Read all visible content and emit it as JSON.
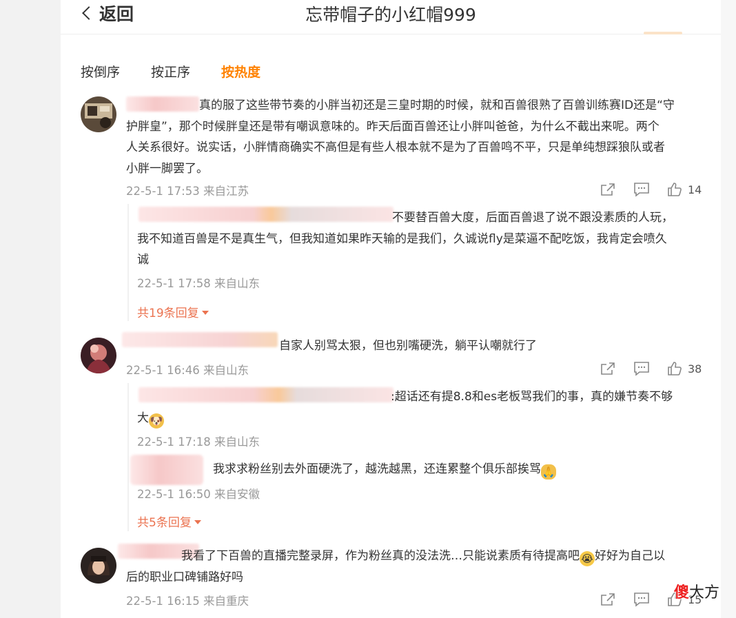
{
  "header": {
    "back_label": "返回",
    "title": "忘带帽子的小红帽999"
  },
  "sort_tabs": [
    {
      "label": "按倒序",
      "active": false
    },
    {
      "label": "按正序",
      "active": false
    },
    {
      "label": "按热度",
      "active": true
    }
  ],
  "comments": [
    {
      "text_lines": [
        "真的服了这些带节奏的小胖当初还是三皇时期的时候，就和百兽很熟了百兽训练赛ID还是“守",
        "护胖皇”，那个时候胖皇还是带有嘲讽意味的。昨天后面百兽还让小胖叫爸爸，为什么不截出来呢。两个",
        "人关系很好。说实话，小胖情商确实不高但是有些人根本就不是为了百兽鸣不平，只是单纯想踩狼队或者",
        "小胖一脚罢了。"
      ],
      "meta": "22-5-1 17:53 来自江苏",
      "likes": "14",
      "replies": [
        {
          "text_lines": [
            "不要替百兽大度，后面百兽退了说不跟没素质的人玩，",
            "我不知道百兽是不是真生气，但我知道如果昨天输的是我们，久诚说fly是菜逼不配吃饭，我肯定会喷久",
            "诚"
          ],
          "meta": "22-5-1 17:58 来自山东"
        }
      ],
      "more_label": "共19条回复"
    },
    {
      "text_lines": [
        "自家人别骂太狠，但也别嘴硬洗，躺平认嘲就行了"
      ],
      "meta": "22-5-1 16:46 来自山东",
      "likes": "38",
      "replies": [
        {
          "text_lines": [
            ":超话还有提8.8和es老板骂我们的事，真的嫌节奏不够",
            "大"
          ],
          "meta": "22-5-1 17:18 来自山东"
        },
        {
          "text_lines": [
            "我求求粉丝别去外面硬洗了，越洗越黑，还连累整个俱乐部挨骂"
          ],
          "meta": "22-5-1 16:50 来自安徽"
        }
      ],
      "more_label": "共5条回复"
    },
    {
      "text_lines": [
        "我看了下百兽的直播完整录屏，作为粉丝真的没法洗…只能说素质有待提高吧",
        "好好为自己以",
        "后的职业口碑铺路好吗"
      ],
      "meta": "22-5-1 16:15 来自重庆",
      "likes": "15"
    }
  ],
  "icons": {
    "share": "share-icon",
    "comment": "comment-icon",
    "like": "like-icon"
  },
  "watermark": {
    "part1": "傻",
    "part2": "大方"
  },
  "colors": {
    "accent": "#ff8200",
    "reply_link": "#eb7350",
    "meta": "#999999"
  }
}
